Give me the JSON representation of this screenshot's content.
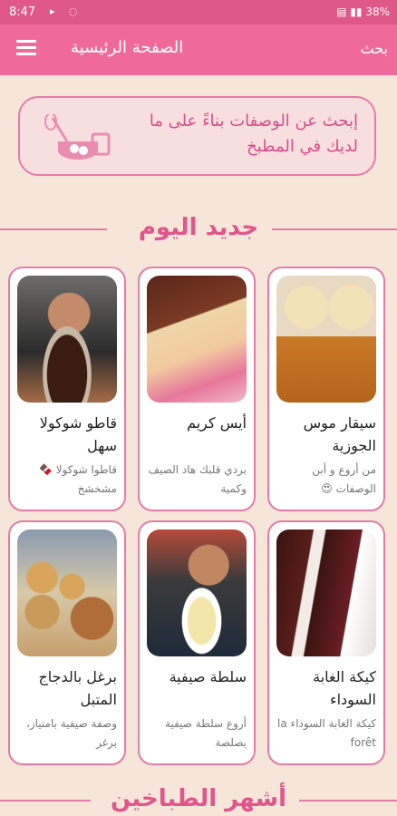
{
  "status": {
    "time": "8:47",
    "battery": "38%"
  },
  "appbar": {
    "title": "الصفحة الرئيسية",
    "search": "بحث"
  },
  "search_banner": {
    "text": "إبحث عن الوصفات بناءً على ما لديك في المطبخ"
  },
  "sections": {
    "new_today": "جديد اليوم",
    "popular_chefs": "أشهر الطباخين"
  },
  "cards": [
    {
      "title": "سيقار موس الجوزية",
      "desc": "من أروع و أبن الوصفات 😍"
    },
    {
      "title": "أيس كريم",
      "desc": "بردي قلبك هاد الصيف وكمية"
    },
    {
      "title": "قاطو شوكولا سهل",
      "desc": "قاطوا شوكولا 🍫 مشخشخ"
    },
    {
      "title": "كيكة الغابة السوداء",
      "desc": "كيكة الغابة السوداء la forêt"
    },
    {
      "title": "سلطة صيفية",
      "desc": "أروع سلطة صيفية بصلصة"
    },
    {
      "title": "برغل بالدجاج المتبل",
      "desc": "وصفة صيفية بامتياز، برغر"
    }
  ],
  "colors": {
    "primary": "#ef6a9b",
    "accent": "#e1548c",
    "background": "#f6e6da"
  }
}
